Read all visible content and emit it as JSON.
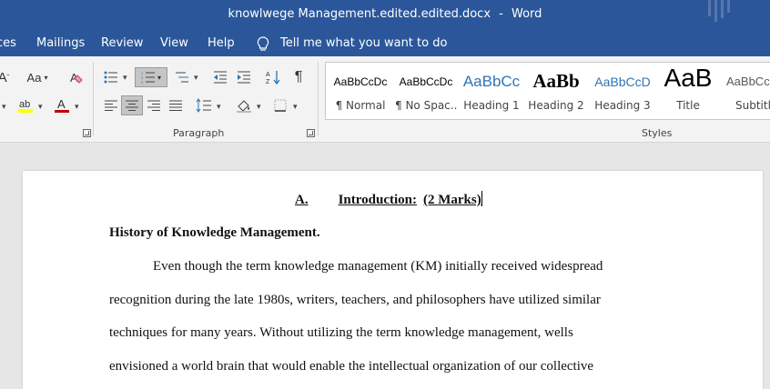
{
  "app": {
    "title": "knowlwege Management.edited.edited.docx",
    "separator": "-",
    "app_name": "Word"
  },
  "menu": {
    "items": [
      "ces",
      "Mailings",
      "Review",
      "View",
      "Help"
    ],
    "tell_me": "Tell me what you want to do"
  },
  "ribbon": {
    "paragraph_label": "Paragraph",
    "styles_label": "Styles",
    "font_size_label": "Aa",
    "styles": [
      {
        "preview": "AaBbCcDc",
        "name": "¶ Normal"
      },
      {
        "preview": "AaBbCcDc",
        "name": "¶ No Spac..."
      },
      {
        "preview": "AaBbCc",
        "name": "Heading 1"
      },
      {
        "preview": "AaBb",
        "name": "Heading 2"
      },
      {
        "preview": "AaBbCcD",
        "name": "Heading 3"
      },
      {
        "preview": "AaB",
        "name": "Title"
      },
      {
        "preview": "AaBbCc",
        "name": "Subtitle"
      }
    ]
  },
  "document": {
    "heading_letter": "A.",
    "heading_text": "Introduction:",
    "heading_marks": "(2 Marks)",
    "subheading": "History of Knowledge Management.",
    "lines": [
      "Even though the term knowledge management (KM) initially received widespread",
      "recognition during the late 1980s, writers, teachers, and philosophers have utilized similar",
      "techniques for many years. Without utilizing the term knowledge management, wells",
      "envisioned a world brain that would enable the intellectual organization of our collective"
    ]
  },
  "colors": {
    "title_bar": "#2b579a",
    "ribbon_bg": "#f3f3f3",
    "heading1_blue": "#2e74b5",
    "font_color_red": "#c00000",
    "highlight_yellow": "#ffff00"
  }
}
